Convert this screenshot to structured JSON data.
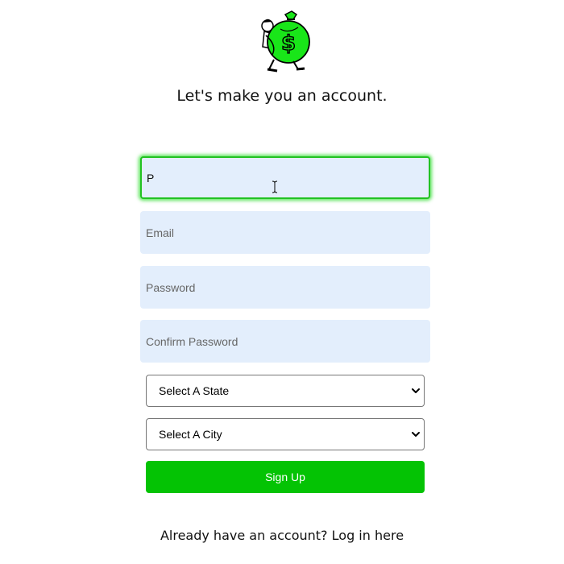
{
  "heading": "Let's make you an account.",
  "form": {
    "name_value": "P",
    "email_placeholder": "Email",
    "password_placeholder": "Password",
    "confirm_password_placeholder": "Confirm Password",
    "state_select": "Select A State",
    "city_select": "Select A City",
    "signup_label": "Sign Up"
  },
  "footer": {
    "prompt": "Already have an account?",
    "login_link": "Log in here"
  },
  "icons": {
    "logo": "money-bag-logo-icon",
    "cursor": "text-cursor-icon",
    "dropdown": "chevron-down-icon"
  },
  "colors": {
    "accent": "#04c304",
    "input_bg": "#e3eefc",
    "focus_ring": "#22c222",
    "logo_bag": "#19e619"
  }
}
